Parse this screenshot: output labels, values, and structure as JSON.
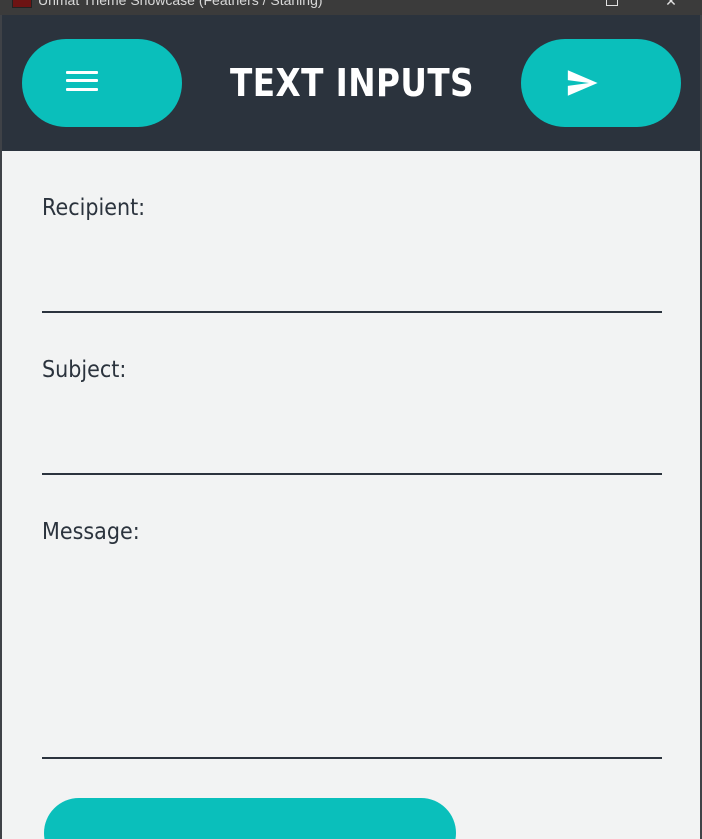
{
  "window": {
    "title": "Unmat Theme Showcase (Feathers / Starling)",
    "maximize_icon": "maximize-icon",
    "close_icon": "close-icon",
    "close_glyph": "✕"
  },
  "header": {
    "title": "TEXT INPUTS",
    "menu_icon": "hamburger-menu-icon",
    "send_icon": "send-icon",
    "accent_color": "#0abfbb",
    "background_color": "#2b333d"
  },
  "form": {
    "recipient": {
      "label": "Recipient:",
      "value": ""
    },
    "subject": {
      "label": "Subject:",
      "value": ""
    },
    "message": {
      "label": "Message:",
      "value": ""
    }
  },
  "colors": {
    "content_background": "#f2f3f3",
    "text": "#2b333d"
  }
}
